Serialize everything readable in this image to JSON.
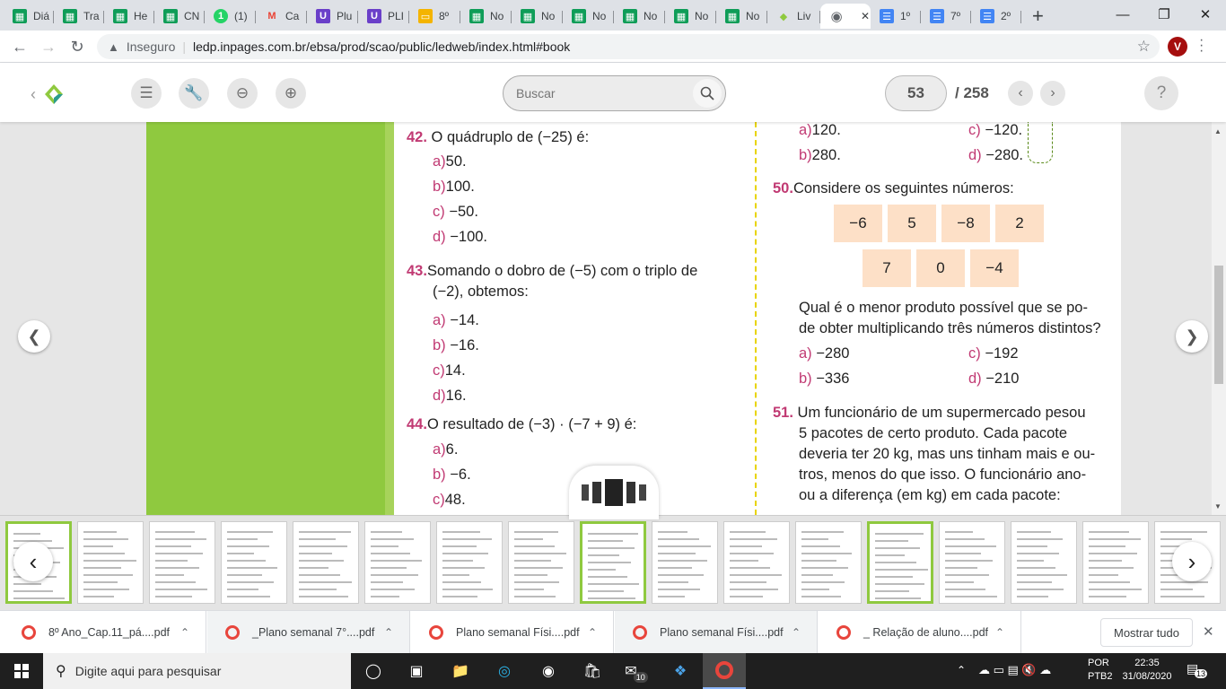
{
  "browser": {
    "tabs": [
      {
        "label": "Diá",
        "icon": "google-sheets-icon",
        "color": "#0f9d58"
      },
      {
        "label": "Tra",
        "icon": "google-sheets-icon",
        "color": "#0f9d58"
      },
      {
        "label": "He",
        "icon": "google-sheets-icon",
        "color": "#0f9d58"
      },
      {
        "label": "CN",
        "icon": "google-sheets-icon",
        "color": "#0f9d58"
      },
      {
        "label": "(1)",
        "icon": "whatsapp-icon",
        "color": "#25d366"
      },
      {
        "label": "Ca",
        "icon": "gmail-icon",
        "color": "#ea4335"
      },
      {
        "label": "Plu",
        "icon": "app-icon",
        "color": "#6a3fc9"
      },
      {
        "label": "PLI",
        "icon": "app-icon",
        "color": "#6a3fc9"
      },
      {
        "label": "8º",
        "icon": "slides-icon",
        "color": "#f4b400"
      },
      {
        "label": "No",
        "icon": "google-sheets-icon",
        "color": "#0f9d58"
      },
      {
        "label": "No",
        "icon": "google-sheets-icon",
        "color": "#0f9d58"
      },
      {
        "label": "No",
        "icon": "google-sheets-icon",
        "color": "#0f9d58"
      },
      {
        "label": "No",
        "icon": "google-sheets-icon",
        "color": "#0f9d58"
      },
      {
        "label": "No",
        "icon": "google-sheets-icon",
        "color": "#0f9d58"
      },
      {
        "label": "No",
        "icon": "google-sheets-icon",
        "color": "#0f9d58"
      },
      {
        "label": "Liv",
        "icon": "ledweb-icon",
        "color": "#8fc93f"
      },
      {
        "label": "",
        "icon": "globe-icon",
        "color": "#5f6368"
      },
      {
        "label": "1º",
        "icon": "google-docs-icon",
        "color": "#4285f4"
      },
      {
        "label": "7º",
        "icon": "google-docs-icon",
        "color": "#4285f4"
      },
      {
        "label": "2º",
        "icon": "google-docs-icon",
        "color": "#4285f4"
      }
    ],
    "new_tab": "+",
    "security_label": "Inseguro",
    "url": "ledp.inpages.com.br/ebsa/prod/scao/public/ledweb/index.html#book",
    "profile_initial": "V"
  },
  "reader": {
    "search_placeholder": "Buscar",
    "current_page": "53",
    "total_pages": "/ 258",
    "help": "?"
  },
  "page": {
    "q42": {
      "num": "42.",
      "text": "O quádruplo de (−25) é:",
      "options": [
        [
          "a)",
          "50."
        ],
        [
          "b)",
          "100."
        ],
        [
          "c)",
          "−50."
        ],
        [
          "d)",
          "−100."
        ]
      ]
    },
    "q43": {
      "num": "43.",
      "line1": "Somando o dobro de (−5) com o triplo de",
      "line2": "(−2), obtemos:",
      "options": [
        [
          "a)",
          "−14."
        ],
        [
          "b)",
          "−16."
        ],
        [
          "c)",
          "14."
        ],
        [
          "d)",
          "16."
        ]
      ]
    },
    "q44": {
      "num": "44.",
      "text": "O resultado de (−3) · (−7 + 9) é:",
      "options": [
        [
          "a)",
          "6."
        ],
        [
          "b)",
          "−6."
        ],
        [
          "c)",
          "48."
        ]
      ]
    },
    "prev_options": [
      [
        "a)",
        "120."
      ],
      [
        "c)",
        "−120."
      ],
      [
        "b)",
        "280."
      ],
      [
        "d)",
        "−280."
      ]
    ],
    "q50": {
      "num": "50.",
      "text": "Considere os seguintes números:",
      "row1": [
        "−6",
        "5",
        "−8",
        "2"
      ],
      "row2": [
        "7",
        "0",
        "−4"
      ],
      "line1": "Qual é o menor produto possível que se po-",
      "line2": "de obter multiplicando três números distintos?",
      "options": [
        [
          "a)",
          "−280"
        ],
        [
          "c)",
          "−192"
        ],
        [
          "b)",
          "−336"
        ],
        [
          "d)",
          "−210"
        ]
      ]
    },
    "q51": {
      "num": "51.",
      "lines": [
        "Um funcionário de um supermercado pesou",
        "5 pacotes de certo produto. Cada pacote",
        "deveria ter 20 kg, mas uns tinham mais e ou-",
        "tros, menos do que isso. O funcionário ano-",
        "ou a diferença (em kg) em cada pacote:"
      ]
    }
  },
  "downloads": {
    "items": [
      "8º Ano_Cap.11_pá....pdf",
      "_Plano semanal 7°....pdf",
      "Plano semanal Físi....pdf",
      "Plano semanal Físi....pdf",
      "_ Relação de aluno....pdf"
    ],
    "show_all": "Mostrar tudo"
  },
  "taskbar": {
    "search_placeholder": "Digite aqui para pesquisar",
    "mail_badge": "10",
    "lang1": "POR",
    "lang2": "PTB2",
    "time": "22:35",
    "date": "31/08/2020",
    "notif_count": "13"
  }
}
